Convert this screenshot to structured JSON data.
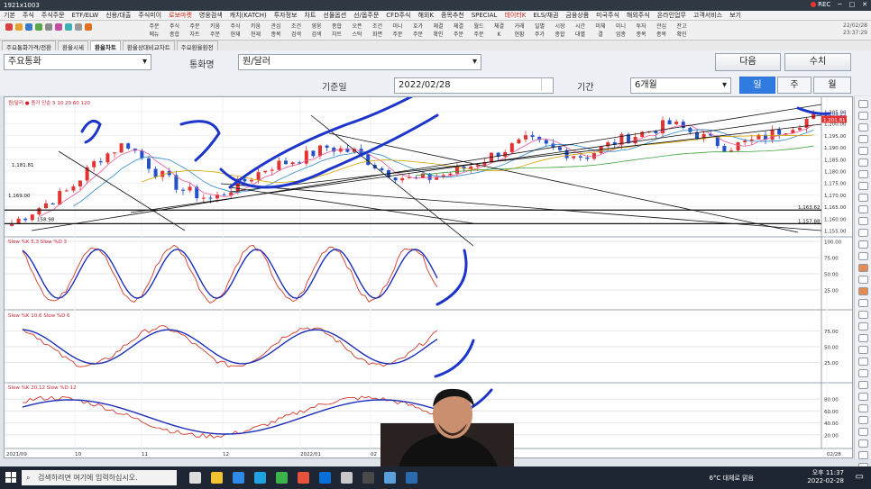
{
  "window": {
    "title": "1921x1003",
    "rec_label": "REC"
  },
  "menu": [
    "기본",
    "주식",
    "주식주문",
    "ETF/ELW",
    "신용/대출",
    "주식미이",
    "로보마켓",
    "영웅검색",
    "캐치(KATCH)",
    "투자정보",
    "차트",
    "선물옵션",
    "선/옵주문",
    "CFD주식",
    "해외K",
    "종목추천",
    "SPECIAL",
    "데이터K",
    "ELS/채권",
    "금융상품",
    "미국주식",
    "해외주식",
    "온라인업무",
    "고객서비스",
    "보기"
  ],
  "menu_highlight": [
    "로보마켓",
    "데이터K"
  ],
  "toolbar": {
    "items": [
      "주문\n메뉴",
      "주식\n종합",
      "주문\n차트",
      "키움\n주문",
      "주식\n현재",
      "키움\n현재",
      "관심\n종목",
      "조건\n검색",
      "영웅\n검색",
      "종합\n차트",
      "오픈\n스탁",
      "조건\n화면",
      "미니\n주문",
      "호가\n주문",
      "체결\n확인",
      "체결\n주문",
      "월드\n주문",
      "체결\nK",
      "거래\n현황",
      "일별\n주가",
      "시장\n종합",
      "시간\n대별",
      "미체\n결",
      "미니\n업종",
      "투자\n종목",
      "관심\n종목",
      "잔고\n확인"
    ],
    "clock_top": "22/02/28",
    "clock_bottom": "23:37:29"
  },
  "tabs": [
    {
      "label": "주요통화가격/전환"
    },
    {
      "label": "환율시세"
    },
    {
      "label": "환율차트",
      "active": true
    },
    {
      "label": "환율상대비교차트"
    },
    {
      "label": "주요환율환전"
    }
  ],
  "controls": {
    "instrument": "주요통화",
    "currency_label": "통화명",
    "currency_value": "원/달러",
    "next_button": "다음",
    "value_button": "수치",
    "date_label": "기준일",
    "date_value": "2022/02/28",
    "period_label": "기간",
    "period_value": "6개월",
    "seg_day": "일",
    "seg_week": "주",
    "seg_month": "월"
  },
  "chart": {
    "price_title": "원/달러 ● 종가 단순 5 10 20 60 120",
    "price_labels": {
      "p1181": "1,181.81",
      "p1169": "1,169.00",
      "p1158": "158.98",
      "p1163": "1,163.62",
      "p1157": "1,157.88"
    },
    "right_axis": [
      "1,205.00",
      "1,200.00",
      "1,195.00",
      "1,190.00",
      "1,185.00",
      "1,180.00",
      "1,175.00",
      "1,170.00",
      "1,165.00",
      "1,160.00",
      "1,155.00"
    ],
    "right_flags": [
      "1,204.25",
      "1,201.81"
    ],
    "stoch1": {
      "title": "Slow %K 5,3  Slow %D 3",
      "axis": [
        "100.00",
        "75.00",
        "50.00",
        "25.00"
      ]
    },
    "stoch2": {
      "title": "Slow %K 10,6  Slow %D 6",
      "axis": [
        "75.00",
        "50.00",
        "25.00"
      ]
    },
    "stoch3": {
      "title": "Slow %K 20,12  Slow %D 12",
      "axis": [
        "80.00",
        "60.00",
        "40.00",
        "20.00"
      ]
    },
    "x_axis": [
      "2021/09",
      "10",
      "11",
      "12",
      "2022/01",
      "02",
      "02/28"
    ]
  },
  "taskbar": {
    "search_placeholder": "검색하려면 여기에 입력하십시오.",
    "weather": "6°C 대체로 맑음",
    "time": "오후 11:37",
    "date": "2022-02-28"
  },
  "colors": {
    "up": "#e23232",
    "down": "#2451c9",
    "annotation": "#1d36c9",
    "k_line": "#d23b2a",
    "d_line": "#1d2fb8"
  }
}
